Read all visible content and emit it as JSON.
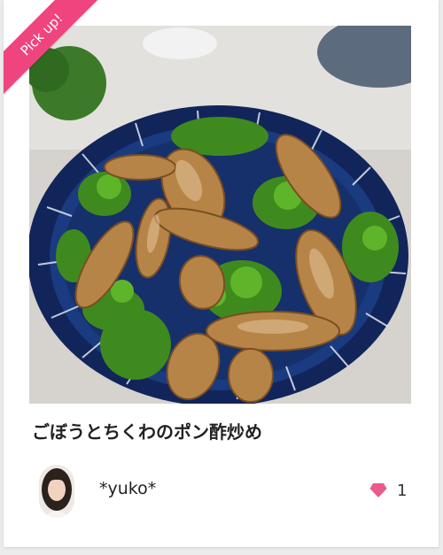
{
  "badge": {
    "label": "Pick up!"
  },
  "recipe": {
    "title": "ごぼうとちくわのポン酢炒め",
    "author": "*yuko*",
    "like_count": "1"
  },
  "icons": {
    "like": "heart-icon",
    "avatar": "user-avatar"
  },
  "colors": {
    "accent": "#f0447e",
    "like_heart": "#ea5a8c",
    "plate": "#14285a"
  }
}
